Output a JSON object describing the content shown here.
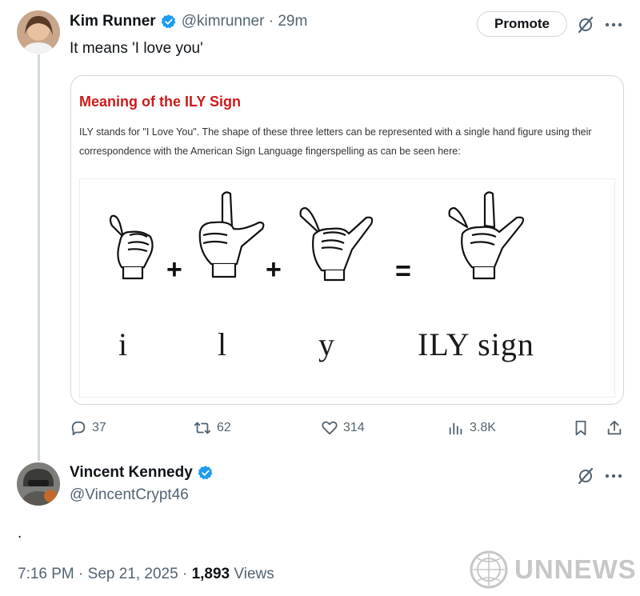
{
  "tweet1": {
    "author_name": "Kim Runner",
    "handle_time": "@kimrunner · 29m",
    "text": "It means 'I love you'",
    "promote_label": "Promote",
    "card": {
      "title": "Meaning of the ILY Sign",
      "description": "ILY stands for \"I Love You\". The shape of these three letters can be represented with a single hand figure using their correspondence with the American Sign Language fingerspelling as can be seen here:",
      "labels": {
        "i": "i",
        "l": "l",
        "y": "y",
        "ily": "ILY sign"
      },
      "operators": {
        "plus1": "+",
        "plus2": "+",
        "equals": "="
      }
    },
    "stats": {
      "replies": "37",
      "reposts": "62",
      "likes": "314",
      "views": "3.8K"
    }
  },
  "tweet2": {
    "author_name": "Vincent Kennedy",
    "handle": "@VincentCrypt46",
    "text": ".",
    "time": "7:16 PM · Sep 21, 2025 · ",
    "views_count": "1,893",
    "views_label": " Views"
  },
  "watermark": "UNNEWS",
  "colors": {
    "verified": "#1d9bf0",
    "card_title": "#cc1b1b",
    "muted": "#536471",
    "border": "#cfd9de"
  },
  "icons": [
    "verified-badge-icon",
    "grok-icon",
    "more-icon",
    "reply-icon",
    "repost-icon",
    "like-icon",
    "views-icon",
    "bookmark-icon",
    "share-icon",
    "un-emblem-icon"
  ]
}
